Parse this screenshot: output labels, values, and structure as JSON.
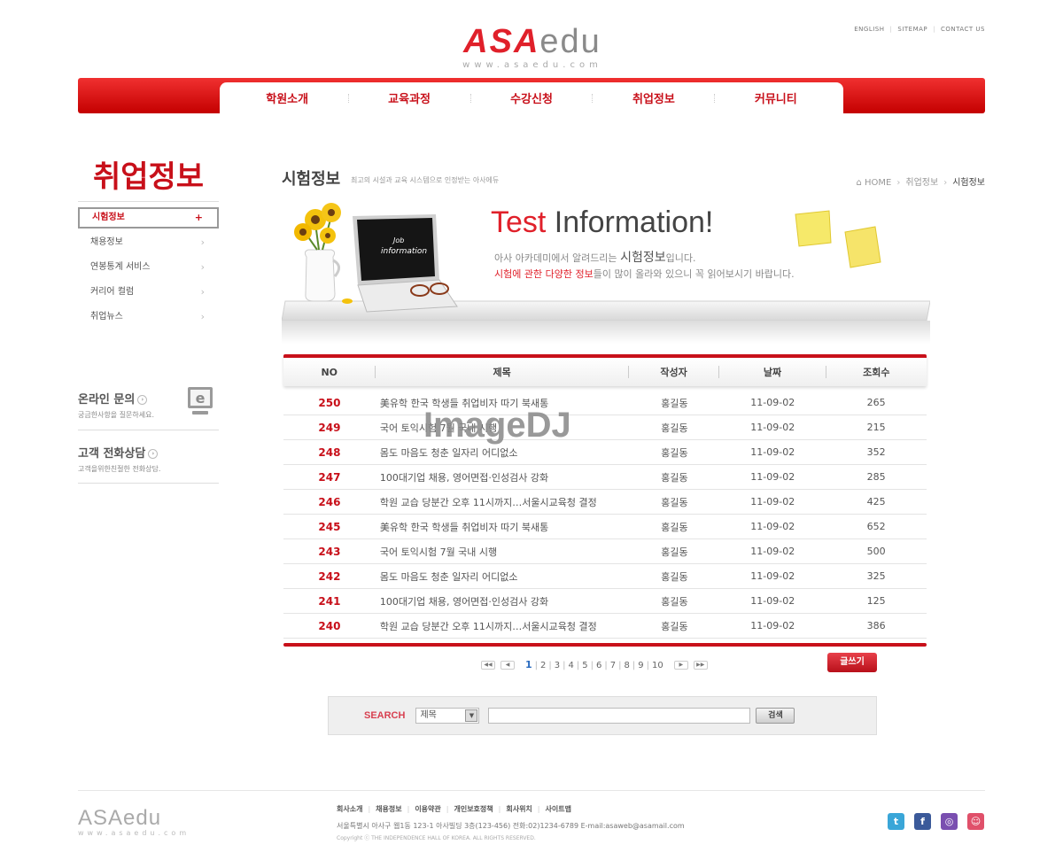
{
  "header": {
    "logo_main_asa": "ASA",
    "logo_main_edu": "edu",
    "logo_url": "www.asaedu.com",
    "toplinks": [
      "ENGLISH",
      "SITEMAP",
      "CONTACT US"
    ]
  },
  "gnb": [
    "학원소개",
    "교육과정",
    "수강신청",
    "취업정보",
    "커뮤니티"
  ],
  "sidebar": {
    "title": "취업정보",
    "items": [
      {
        "label": "시험정보",
        "active": true,
        "mark": "+"
      },
      {
        "label": "채용정보",
        "mark": "›"
      },
      {
        "label": "연봉통계 서비스",
        "mark": "›"
      },
      {
        "label": "커리어 컬럼",
        "mark": "›"
      },
      {
        "label": "취업뉴스",
        "mark": "›"
      }
    ],
    "online": {
      "title": "온라인 문의",
      "sub": "궁금한사항을 질문하세요.",
      "icon_label": "e"
    },
    "phone": {
      "title": "고객 전화상담",
      "sub": "고객을위한친절한 전화상담."
    }
  },
  "content": {
    "title": "시험정보",
    "desc": "최고의 시설과 교육 시스템으로 인정받는 아사에듀",
    "breadcrumb": {
      "home": "HOME",
      "parent": "취업정보",
      "current": "시험정보"
    },
    "banner": {
      "title_red": "Test",
      "title_rest": " Information!",
      "line1_pre": "아사 아카데미에서 알려드리는 ",
      "line1_bold": "시험정보",
      "line1_post": "입니다.",
      "line2_red": "시험에 관한 다양한 정보",
      "line2_post": "들이 많이 올라와 있으니 꼭 읽어보시기 바랍니다.",
      "laptop_text_1": "Job",
      "laptop_text_2": "information"
    }
  },
  "table": {
    "headers": {
      "no": "NO",
      "title": "제목",
      "author": "작성자",
      "date": "날짜",
      "views": "조회수"
    },
    "rows": [
      {
        "no": "250",
        "title": "美유학 한국 학생들 취업비자 따기 북새통",
        "author": "홍길동",
        "date": "11-09-02",
        "views": "265"
      },
      {
        "no": "249",
        "title": "국어 토익시험 7월 국내 시행",
        "author": "홍길동",
        "date": "11-09-02",
        "views": "215"
      },
      {
        "no": "248",
        "title": "몸도 마음도 청춘 일자리 어디없소",
        "author": "홍길동",
        "date": "11-09-02",
        "views": "352"
      },
      {
        "no": "247",
        "title": "100대기업 채용,  영어면접·인성검사 강화",
        "author": "홍길동",
        "date": "11-09-02",
        "views": "285"
      },
      {
        "no": "246",
        "title": "학원 교습 당분간 오후 11시까지…서울시교육청 결정",
        "author": "홍길동",
        "date": "11-09-02",
        "views": "425"
      },
      {
        "no": "245",
        "title": "美유학 한국 학생들 취업비자 따기 북새통",
        "author": "홍길동",
        "date": "11-09-02",
        "views": "652"
      },
      {
        "no": "243",
        "title": "국어 토익시험 7월 국내 시행",
        "author": "홍길동",
        "date": "11-09-02",
        "views": "500"
      },
      {
        "no": "242",
        "title": "몸도 마음도 청춘 일자리 어디없소",
        "author": "홍길동",
        "date": "11-09-02",
        "views": "325"
      },
      {
        "no": "241",
        "title": "100대기업 채용,  영어면접·인성검사 강화",
        "author": "홍길동",
        "date": "11-09-02",
        "views": "125"
      },
      {
        "no": "240",
        "title": "학원 교습 당분간 오후 11시까지…서울시교육청 결정",
        "author": "홍길동",
        "date": "11-09-02",
        "views": "386"
      }
    ]
  },
  "pager": {
    "first": "◀◀",
    "prev": "◀",
    "next": "▶",
    "last": "▶▶",
    "pages": [
      "1",
      "2",
      "3",
      "4",
      "5",
      "6",
      "7",
      "8",
      "9",
      "10"
    ],
    "current": "1"
  },
  "write_label": "글쓰기",
  "search": {
    "label": "SEARCH",
    "select_value": "제목",
    "button": "검색",
    "input_value": ""
  },
  "footer": {
    "logo": "ASAedu",
    "logo_url": "www.asaedu.com",
    "links": [
      "회사소개",
      "채용정보",
      "이용약관",
      "개인보호정책",
      "회사위치",
      "사이트맵"
    ],
    "address": "서울특별시 아사구 웹1동 123-1 아사빌딩 3층(123-456) 전화:02)1234-6789 E-mail:asaweb@asamail.com",
    "copyright": "Copyright ⓒ THE INDEPENDENCE HALL OF KOREA. ALL RIGHTS RESERVED.",
    "sns": [
      {
        "name": "twitter-icon",
        "glyph": "t",
        "color": "#3aa6d8"
      },
      {
        "name": "facebook-icon",
        "glyph": "f",
        "color": "#3b5a9a"
      },
      {
        "name": "blog-icon",
        "glyph": "◎",
        "color": "#7a4fb0"
      },
      {
        "name": "me2day-icon",
        "glyph": "☺",
        "color": "#e0506a"
      }
    ]
  },
  "watermark": "ImageDJ",
  "colors": {
    "accent": "#c8101a",
    "brand_red": "#e0202a"
  }
}
